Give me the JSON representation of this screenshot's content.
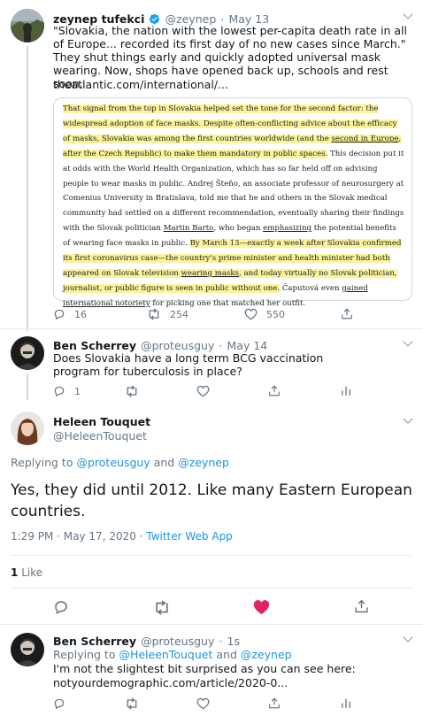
{
  "tweet1": {
    "name": "zeynep tufekci",
    "handle": "@zeynep",
    "sep": "·",
    "date": "May 13",
    "text": "\"Slovakia, the nation with the lowest per-capita death rate in all of Europe... recorded its first day of no new cases since March.\" They shut things early and quickly adopted universal mask wearing. Now, shops have opened back up, schools and rest soon.",
    "link": "theatlantic.com/international/...",
    "book_excerpt": {
      "p1": "That signal from the top in Slovakia helped set the tone for the second factor: the widespread adoption of face masks. Despite often-conflicting advice about the efficacy of masks, Slovakia was among the first countries worldwide (and the ",
      "p1_u": "second in Europe",
      "p1_b": ", after the Czech Republic) to make them mandatory in public spaces.",
      "p2": " This decision put it at odds with the World Health Organization, which has so far held off on advising people to wear masks in public. Andrej Šteňo, an associate professor of neurosurgery at Comenius University in Bratislava, told me that he and others in the Slovak medical community had settled on a different recommendation, eventually sharing their findings with the Slovak politician ",
      "p2_u1": "Martin Barto",
      "p2_c": ", who began ",
      "p2_u2": "emphasizing",
      "p2_d": " the potential benefits of wearing face masks in public. ",
      "p3": "By March 13—exactly a week after Slovakia confirmed its first coronavirus case—the country's prime minister and health minister had both appeared on Slovak television ",
      "p3_u": "wearing masks",
      "p3_b": ", and today virtually no Slovak politician, journalist, or public figure is seen in public without one.",
      "p4": " Čaputová even ",
      "p4_u": "gained international notoriety",
      "p4_b": " for picking one that matched her outfit."
    },
    "replies": "16",
    "retweets": "254",
    "likes": "550"
  },
  "tweet2": {
    "name": "Ben Scherrey",
    "handle": "@proteusguy",
    "sep": "·",
    "date": "May 14",
    "text": "Does Slovakia have a long term BCG vaccination program for tuberculosis in place?",
    "replies": "1"
  },
  "main_tweet": {
    "name": "Heleen Touquet",
    "handle": "@HeleenTouquet",
    "replying_prefix": "Replying to",
    "replying_to_1": "@proteusguy",
    "replying_and": "and",
    "replying_to_2": "@zeynep",
    "text": "Yes, they did until 2012. Like many Eastern European countries.",
    "time": "1:29 PM · May 17, 2020",
    "sep": "·",
    "source": "Twitter Web App",
    "like_count": "1",
    "like_label": "Like"
  },
  "tweet3": {
    "name": "Ben Scherrey",
    "handle": "@proteusguy",
    "sep": "·",
    "date": "1s",
    "replying_prefix": "Replying to",
    "replying_to_1": "@HeleenTouquet",
    "replying_and": "and",
    "replying_to_2": "@zeynep",
    "text": "I'm not the slightest bit surprised as you can see here:",
    "link": "notyourdemographic.com/article/2020-0..."
  },
  "colors": {
    "accent": "#1b95e0",
    "like_active": "#e0245e",
    "muted": "#657786",
    "highlight": "#fbf49a"
  }
}
